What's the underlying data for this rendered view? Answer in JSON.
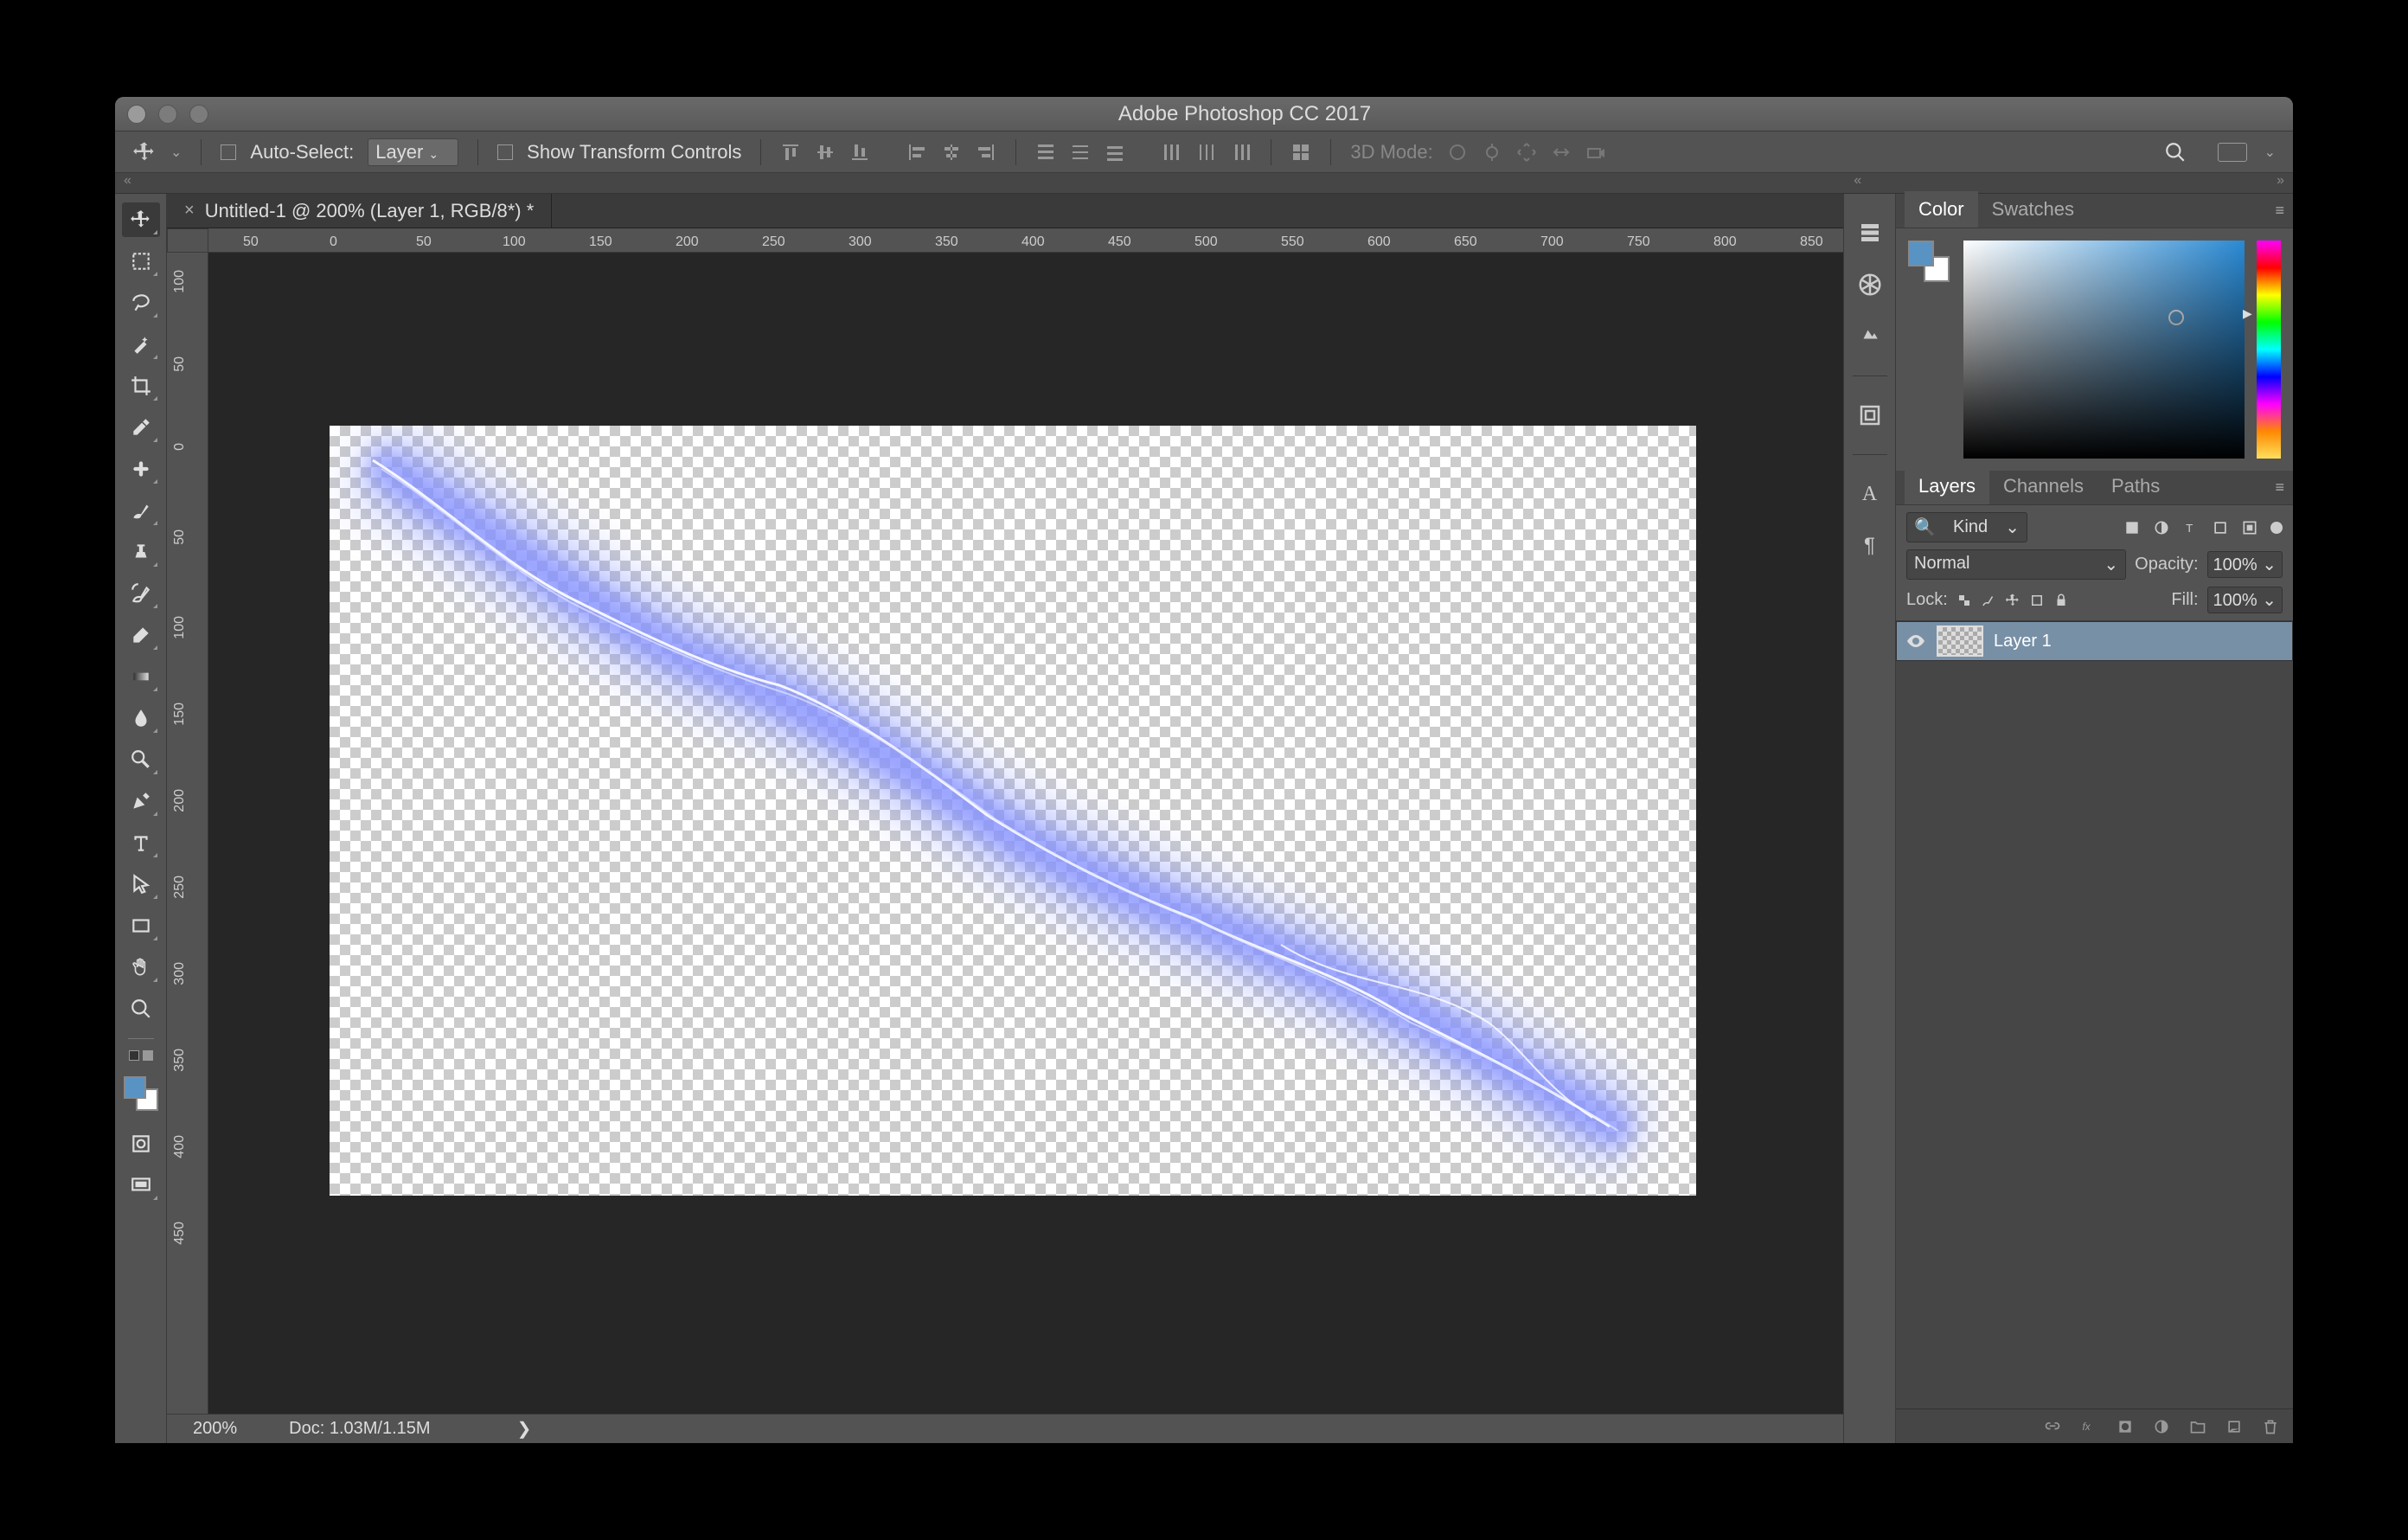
{
  "titlebar": {
    "title": "Adobe Photoshop CC 2017"
  },
  "optionsbar": {
    "auto_select_label": "Auto-Select:",
    "auto_select_target": "Layer",
    "show_transform_label": "Show Transform Controls",
    "threed_mode_label": "3D Mode:"
  },
  "tab": {
    "title": "Untitled-1 @ 200% (Layer 1, RGB/8*) *"
  },
  "ruler_h": [
    "50",
    "0",
    "50",
    "100",
    "150",
    "200",
    "250",
    "300",
    "350",
    "400",
    "450",
    "500",
    "550",
    "600",
    "650",
    "700",
    "750",
    "800",
    "850"
  ],
  "ruler_v": [
    "100",
    "50",
    "0",
    "50",
    "100",
    "150",
    "200",
    "250",
    "300",
    "350",
    "400",
    "450"
  ],
  "status": {
    "zoom": "200%",
    "doc": "Doc: 1.03M/1.15M"
  },
  "panels": {
    "color_tab": "Color",
    "swatches_tab": "Swatches",
    "layers_tab": "Layers",
    "channels_tab": "Channels",
    "paths_tab": "Paths",
    "kind_label": "Kind",
    "blend_mode": "Normal",
    "opacity_label": "Opacity:",
    "opacity_value": "100%",
    "lock_label": "Lock:",
    "fill_label": "Fill:",
    "fill_value": "100%",
    "layer1_name": "Layer 1"
  }
}
